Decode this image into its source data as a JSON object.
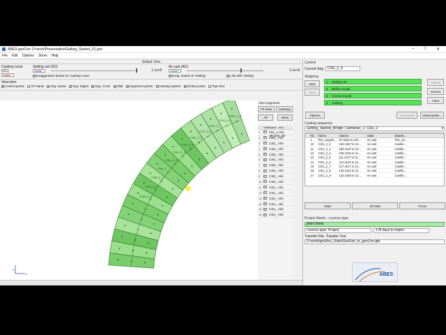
{
  "window": {
    "title": "ABES-geoCon: D:\\work\\Presentation\\Getting_Started_01.gcb",
    "menu": [
      "File",
      "Edit",
      "Options",
      "Show",
      "Help"
    ]
  },
  "global_view": {
    "title": "Global View",
    "casting_curve": {
      "label": "Casting curve (CC)",
      "value": "visible"
    },
    "setting_out": {
      "label": "Setting out (SO)",
      "value": "visible",
      "note": "Exaggeration based on 'Casting curve'"
    },
    "as_cast": {
      "label": "As cast (AC)",
      "value": "visible",
      "note": "Exag. based on 'Setting'",
      "scale_left": "1.1e+0",
      "scale_right": "1.1e+0",
      "link_note": "Link with 'Setting"
    },
    "view_item": {
      "label": "View item",
      "checkboxes": [
        "Control-points",
        "CP Name",
        "Seg. Name",
        "Seg. Edges",
        "Seg. Cond.",
        "Slab",
        "Segment-system",
        "Casting-system",
        "Global points",
        "Topo hint"
      ],
      "glob_dir": "Glob. Dir"
    }
  },
  "view_segments": {
    "title": "View segments",
    "fit_view": "Fit View",
    "cast_seg": "CastSeg",
    "all": "All",
    "none": "None",
    "headers": [
      "View",
      "Name",
      "Info"
    ],
    "items": [
      "Pier_1 Info",
      "CSD_ Info",
      "CSD_ Info",
      "CSD_ Info",
      "CSD_ Info",
      "CSD_ Info",
      "CSD_ Info",
      "CSD_ Info",
      "CSD_ Info",
      "CSD_ Info",
      "CSU_ Info",
      "CSU_ Info",
      "CSU_ Info",
      "CSU_ Info",
      "CSU_ Info",
      "CSU_ Info"
    ]
  },
  "control": {
    "title": "Control",
    "current_seg_label": "Current Seg",
    "current_seg": "CSU_2_9",
    "stepping_title": "Stepping",
    "next": "Next",
    "back": "Back",
    "cancel": "Cancel",
    "correct": "Correct",
    "clear": "Clear",
    "steps": [
      {
        "num": "1",
        "label": "Setting out"
      },
      {
        "num": "2",
        "label": "Define mould"
      },
      {
        "num": "3",
        "label": "Correct mould"
      },
      {
        "num": "4",
        "label": "Casting"
      }
    ],
    "options": "Options",
    "view_quick": "ViewQuick",
    "view_cast": "ViewCastSe..."
  },
  "casting_sequence": {
    "title": "Casting sequence",
    "selector": "Getting_Started_Bridge: Cantilever_1: CSU_2",
    "headers": [
      "No",
      "Name",
      "Station",
      "State",
      "BaseN..."
    ],
    "rows": [
      [
        "1",
        "Pier_Segme...",
        "97.4224 to 102...",
        "As cast",
        "Pier_Se..."
      ],
      [
        "10",
        "CSU_2_2",
        "102.4167 to 10...",
        "As cast",
        "Cantile..."
      ],
      [
        "11",
        "CSU_2_3",
        "105.4137 to 10...",
        "As cast",
        "Cantile..."
      ],
      [
        "12",
        "CSU_2_4",
        "108.4132 to 11...",
        "As cast",
        "Cantile..."
      ],
      [
        "13",
        "CSU_2_5",
        "111.4127 to 11...",
        "As cast",
        "Cantile..."
      ],
      [
        "14",
        "CSU_2_6",
        "114.4122 to 11...",
        "As cast",
        "Cantile..."
      ],
      [
        "15",
        "CSU_2_7",
        "117.4117 to 12...",
        "As cast",
        "Cantile..."
      ],
      [
        "16",
        "CSU_2_8",
        "120.4112 to 12...",
        "As cast",
        "Cantile..."
      ],
      [
        "17",
        "CSU_2_9",
        "123.4106 to 12...",
        "As cast",
        "Cantile..."
      ]
    ],
    "data_btn": "Data",
    "all_data_btn": "All Data",
    "focus_btn": "Focus"
  },
  "licence": {
    "title": "Project Name - Licence type",
    "project": "phm Demo",
    "licence_type": "Licence type: Project",
    "days": "178 days to expire",
    "transfer_label": "Transfer File, Transfer Text",
    "transfer_path": "D:\\work\\geoDes_Doku\\GeoDes_to_geoCon.gtb"
  },
  "logo_text": "ABES",
  "segment_labels": [
    "CSU_2_9",
    "CSU_2_8",
    "CSU_2_7",
    "CSU_2_6",
    "CSU_2_5",
    "CSU_2_4",
    "CSU_2_3",
    "CSU_2_2",
    "Pier_1",
    "CSD_2_2",
    "CSD_2_3",
    "CSD_2_4"
  ],
  "axis_labels": {
    "z": "z",
    "x": "x"
  },
  "colors": {
    "segment_fill": "#7ccf6a",
    "segment_dark": "#3da23a",
    "step_green": "#56e056"
  }
}
